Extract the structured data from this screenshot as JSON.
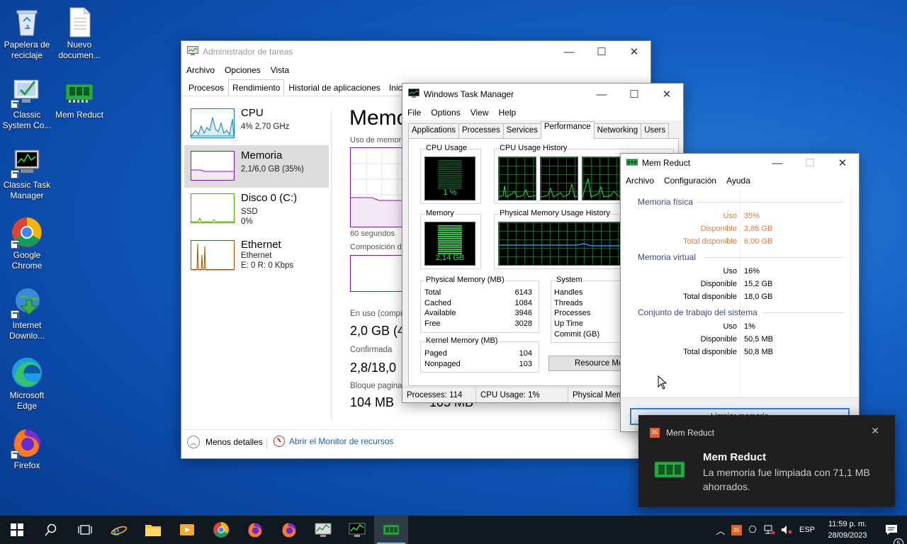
{
  "desktop": {
    "icons": [
      {
        "label": "Papelera de reciclaje"
      },
      {
        "label": "Nuevo documen..."
      },
      {
        "label": "Classic System Co..."
      },
      {
        "label": "Mem Reduct"
      },
      {
        "label": "Classic Task Manager"
      },
      {
        "label": "Google Chrome"
      },
      {
        "label": "Internet Downlo..."
      },
      {
        "label": "Microsoft Edge"
      },
      {
        "label": "Firefox"
      }
    ]
  },
  "taskmgr10": {
    "title": "Administrador de tareas",
    "menu": [
      "Archivo",
      "Opciones",
      "Vista"
    ],
    "tabs": [
      "Procesos",
      "Rendimiento",
      "Historial de aplicaciones",
      "Inicio"
    ],
    "items": [
      {
        "name": "CPU",
        "sub1": "4% 2,70 GHz",
        "sub2": ""
      },
      {
        "name": "Memoria",
        "sub1": "2,1/6,0 GB (35%)",
        "sub2": ""
      },
      {
        "name": "Disco 0 (C:)",
        "sub1": "SSD",
        "sub2": "0%"
      },
      {
        "name": "Ethernet",
        "sub1": "Ethernet",
        "sub2": "E: 0 R: 0 Kbps"
      }
    ],
    "main_title": "Memo",
    "usage_label": "Uso de memor",
    "seconds": "60 segundos",
    "composition": "Composición d",
    "in_use_label": "En uso (compr",
    "in_use_value": "2,0 GB (4",
    "committed_label": "Confirmada",
    "committed_value": "2,8/18,0",
    "paged_label": "Bloque pagina",
    "paged_value": "104 MB",
    "paged_value2": "105 MB",
    "fewer_details": "Menos detalles",
    "open_resmon": "Abrir el Monitor de recursos"
  },
  "taskmgrClassic": {
    "title": "Windows Task Manager",
    "menu": [
      "File",
      "Options",
      "View",
      "Help"
    ],
    "tabs": [
      "Applications",
      "Processes",
      "Services",
      "Performance",
      "Networking",
      "Users"
    ],
    "cpu_usage_label": "CPU Usage",
    "cpu_usage_value": "1 %",
    "cpu_history_label": "CPU Usage History",
    "memory_label": "Memory",
    "memory_value": "2,14 GB",
    "phys_history_label": "Physical Memory Usage History",
    "physical_memory": {
      "title": "Physical Memory (MB)",
      "rows": [
        {
          "k": "Total",
          "v": "6143"
        },
        {
          "k": "Cached",
          "v": "1084"
        },
        {
          "k": "Available",
          "v": "3946"
        },
        {
          "k": "Free",
          "v": "3028"
        }
      ]
    },
    "kernel_memory": {
      "title": "Kernel Memory (MB)",
      "rows": [
        {
          "k": "Paged",
          "v": "104"
        },
        {
          "k": "Nonpaged",
          "v": "103"
        }
      ]
    },
    "system": {
      "title": "System",
      "rows": [
        "Handles",
        "Threads",
        "Processes",
        "Up Time",
        "Commit (GB)"
      ]
    },
    "resource_monitor_button": "Resource Mon",
    "status": {
      "processes": "Processes: 114",
      "cpu": "CPU Usage: 1%",
      "physical": "Physical Mem"
    }
  },
  "memreduct": {
    "title": "Mem Reduct",
    "menu": [
      "Archivo",
      "Configuración",
      "Ayuda"
    ],
    "physical": {
      "title": "Memoria física",
      "rows": [
        {
          "k": "Uso",
          "v": "35%"
        },
        {
          "k": "Disponible",
          "v": "3,85 GB"
        },
        {
          "k": "Total disponible",
          "v": "6,00 GB"
        }
      ]
    },
    "virtual": {
      "title": "Memoria virtual",
      "rows": [
        {
          "k": "Uso",
          "v": "16%"
        },
        {
          "k": "Disponible",
          "v": "15,2 GB"
        },
        {
          "k": "Total disponible",
          "v": "18,0 GB"
        }
      ]
    },
    "working_set": {
      "title": "Conjunto de trabajo del sistema",
      "rows": [
        {
          "k": "Uso",
          "v": "1%"
        },
        {
          "k": "Disponible",
          "v": "50,5 MB"
        },
        {
          "k": "Total disponible",
          "v": "50,8 MB"
        }
      ]
    },
    "clean_button": "Limpiar memoria",
    "accent_color": "#e07a3a"
  },
  "toast": {
    "app": "Mem Reduct",
    "app_badge": "35",
    "title": "Mem Reduct",
    "message": "La memoria fue limpiada con 71,1 MB ahorrados."
  },
  "taskbar": {
    "tray_badge": "35",
    "language": "ESP",
    "time": "11:59 p. m.",
    "date": "28/09/2023",
    "notification_count": "5"
  }
}
